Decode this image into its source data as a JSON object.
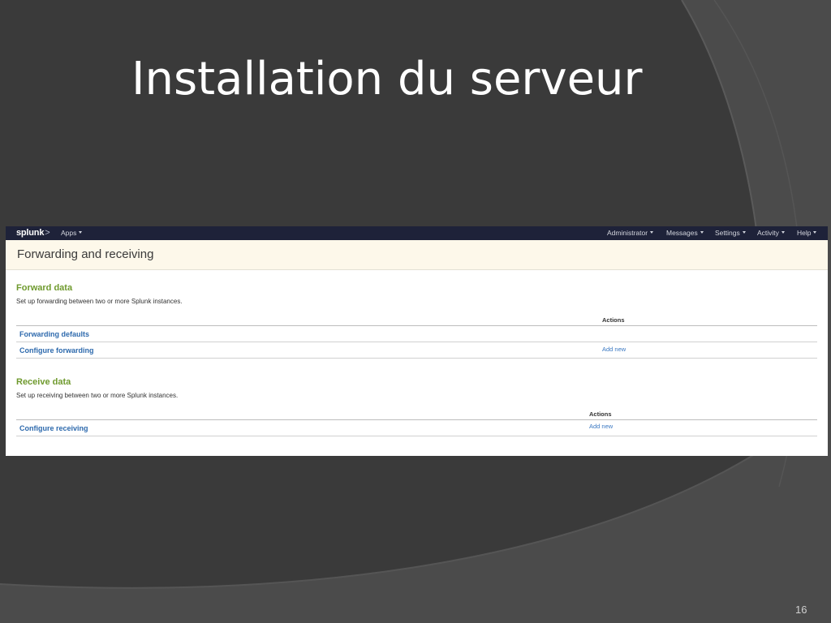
{
  "slide": {
    "title": "Installation du serveur",
    "number": "16",
    "colors": {
      "background_dark": "#3a3a3a",
      "background_mid": "#4a4a4a",
      "title_text": "#ffffff"
    }
  },
  "app": {
    "logo": {
      "name": "splunk",
      "chevron": ">"
    },
    "nav": {
      "apps_label": "Apps",
      "right_items": [
        "Administrator",
        "Messages",
        "Settings",
        "Activity",
        "Help"
      ]
    },
    "page_title": "Forwarding and receiving",
    "colors": {
      "navbar": "#1e2239",
      "header_bg": "#fdf8ea",
      "section_title": "#6f9a2e",
      "link": "#2e6aad"
    },
    "sections": {
      "forward": {
        "title": "Forward data",
        "description": "Set up forwarding between two or more Splunk instances.",
        "actions_header": "Actions",
        "rows": [
          {
            "label": "Forwarding defaults",
            "action": ""
          },
          {
            "label": "Configure forwarding",
            "action": "Add new"
          }
        ]
      },
      "receive": {
        "title": "Receive data",
        "description": "Set up receiving between two or more Splunk instances.",
        "actions_header": "Actions",
        "rows": [
          {
            "label": "Configure receiving",
            "action": "Add new"
          }
        ]
      }
    }
  }
}
